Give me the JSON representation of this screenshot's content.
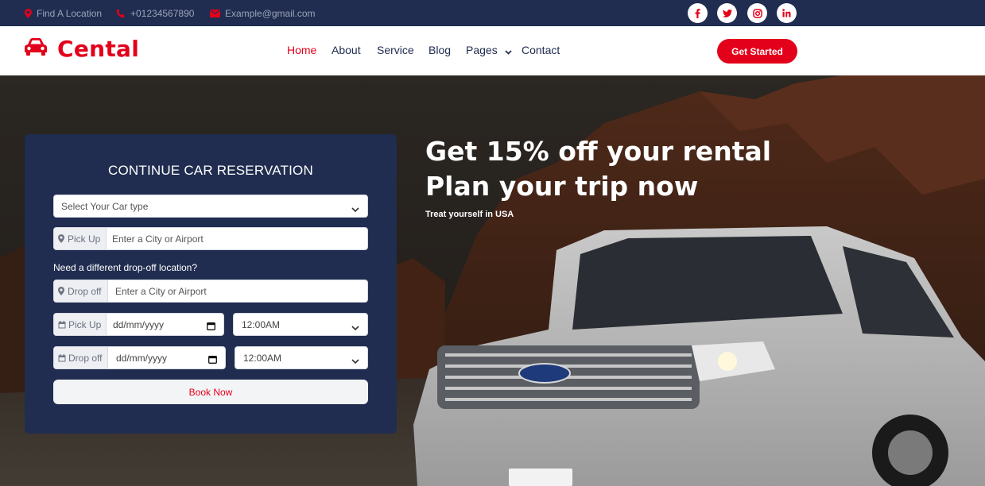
{
  "topbar": {
    "location": "Find A Location",
    "phone": "+01234567890",
    "email": "Example@gmail.com",
    "social": [
      {
        "icon": "facebook-icon",
        "glyph": "f"
      },
      {
        "icon": "twitter-icon",
        "glyph": "t"
      },
      {
        "icon": "instagram-icon",
        "glyph": "ig"
      },
      {
        "icon": "linkedin-icon",
        "glyph": "in"
      }
    ]
  },
  "brand": {
    "name": "Cental",
    "accent": "#e3001b",
    "navy": "#202d50"
  },
  "nav": {
    "items": [
      "Home",
      "About",
      "Service",
      "Blog",
      "Pages",
      "Contact"
    ],
    "active": "Home",
    "cta": "Get Started"
  },
  "form": {
    "title": "CONTINUE CAR RESERVATION",
    "car_type_placeholder": "Select Your Car type",
    "pickup_addon": "Pick Up",
    "pickup_placeholder": "Enter a City or Airport",
    "dropoff_question": "Need a different drop-off location?",
    "dropoff_addon": "Drop off",
    "dropoff_placeholder": "Enter a City or Airport",
    "pickup_date_addon": "Pick Up",
    "pickup_date": "dd/mm/yyyy",
    "pickup_time": "12:00AM",
    "dropoff_date_addon": "Drop off",
    "dropoff_date": "dd/mm/yyyy",
    "dropoff_time": "12:00AM",
    "submit": "Book Now"
  },
  "hero": {
    "headline_line1": "Get 15% off your rental",
    "headline_line2": "Plan your trip now",
    "subline": "Treat yourself in USA"
  }
}
